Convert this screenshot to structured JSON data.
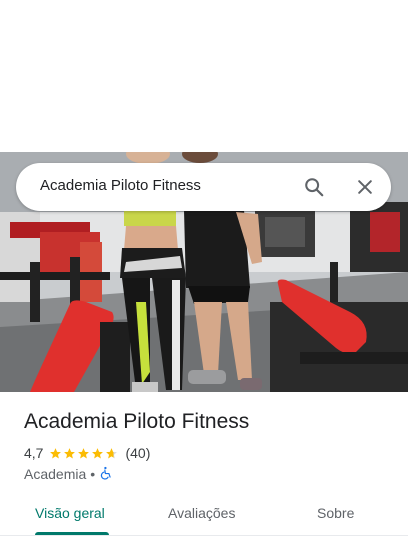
{
  "search": {
    "query": "Academia Piloto Fitness",
    "search_icon": "search-icon",
    "close_icon": "close-icon"
  },
  "photo": {
    "description_icon": "place-photo"
  },
  "place": {
    "title": "Academia Piloto Fitness",
    "rating": "4,7",
    "rating_stars": 4.7,
    "reviews": "(40)",
    "category": "Academia",
    "separator": "•",
    "accessibility_icon": "wheelchair-icon"
  },
  "tabs": [
    {
      "label": "Visão geral",
      "active": true
    },
    {
      "label": "Avaliações",
      "active": false
    },
    {
      "label": "Sobre",
      "active": false
    }
  ],
  "colors": {
    "accent": "#00796b",
    "star": "#fbbc04",
    "accessibility": "#1a73e8"
  }
}
